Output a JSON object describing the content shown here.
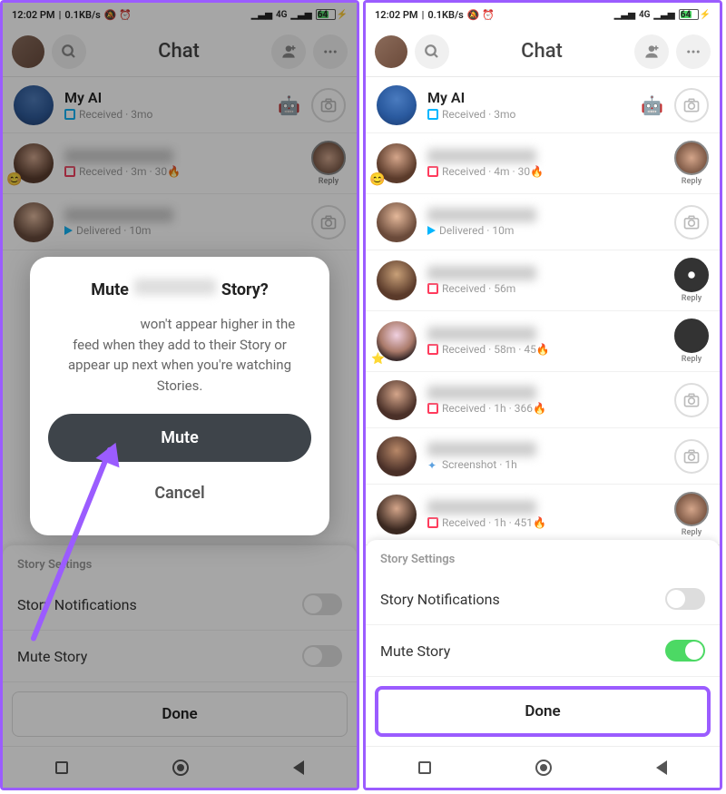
{
  "status": {
    "time": "12:02 PM",
    "net": "0.1KB/s",
    "icons": "🔕 ⏰",
    "sig": "4G",
    "batt": "64"
  },
  "header": {
    "title": "Chat"
  },
  "chats_left": [
    {
      "name": "My AI",
      "meta": "Received · 3mo",
      "type": "blue"
    },
    {
      "meta": "Received · 3m · 30🔥",
      "type": "red",
      "reply": "Reply"
    },
    {
      "meta": "Delivered · 10m",
      "type": "delivered"
    }
  ],
  "chats_right": [
    {
      "name": "My AI",
      "meta": "Received · 3mo",
      "type": "blue"
    },
    {
      "meta": "Received · 4m · 30🔥",
      "type": "red",
      "reply": "Reply"
    },
    {
      "meta": "Delivered · 10m",
      "type": "delivered"
    },
    {
      "meta": "Received · 56m",
      "type": "red",
      "reply": "Reply"
    },
    {
      "meta": "Received · 58m · 45🔥",
      "type": "red",
      "reply": "Reply"
    },
    {
      "meta": "Received · 1h · 366🔥",
      "type": "red"
    },
    {
      "meta": "Screenshot · 1h",
      "type": "screenshot"
    },
    {
      "meta": "Received · 1h · 451🔥",
      "type": "red",
      "reply": "Reply"
    }
  ],
  "modal": {
    "title_prefix": "Mute",
    "title_suffix": "Story?",
    "body_suffix": "won't appear higher in the feed when they add to their Story or appear up next when you're watching Stories.",
    "mute_btn": "Mute",
    "cancel_btn": "Cancel"
  },
  "sheet": {
    "title": "Story Settings",
    "notifications": "Story Notifications",
    "mute_story": "Mute Story",
    "done": "Done"
  }
}
